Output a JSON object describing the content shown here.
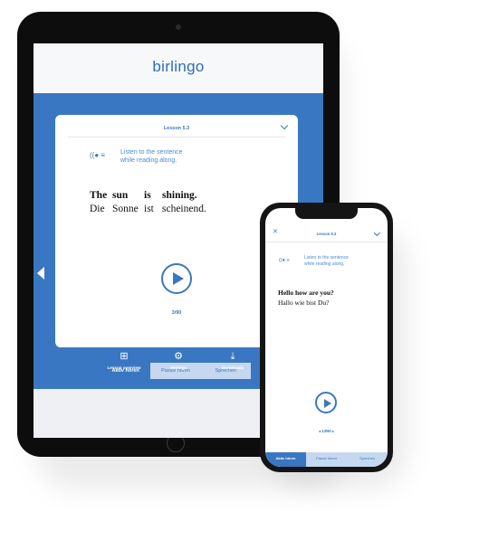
{
  "tablet": {
    "logo": "birlingo",
    "lesson_title": "Lesson 5.3",
    "instruction_line1": "Listen to the sentence",
    "instruction_line2": "while reading along.",
    "sentence_en": [
      "The",
      "sun",
      "is",
      "shining."
    ],
    "sentence_de": [
      "Die",
      "Sonne",
      "ist",
      "scheinend."
    ],
    "counter": "3/90",
    "tabs": [
      {
        "label": "Aktiv hören",
        "active": true
      },
      {
        "label": "Passiv hören",
        "active": false
      },
      {
        "label": "Sprechen",
        "active": false
      }
    ],
    "nav": [
      {
        "label": "Lesson overview",
        "icon": "grid-icon",
        "glyph": "⊞"
      },
      {
        "label": "Settings",
        "icon": "gear-icon",
        "glyph": "⚙"
      },
      {
        "label": "Downloads",
        "icon": "download-icon",
        "glyph": "⤓"
      }
    ],
    "playback_progress": 0.03
  },
  "phone": {
    "close_glyph": "✕",
    "lesson_title": "Lesson 5.3",
    "instruction_line1": "Listen to the sentence",
    "instruction_line2": "while reading along.",
    "sentence_en": "Hello how are you?",
    "sentence_de": "Hallo wie bist Du?",
    "pager": "◂ 13/90 ▸",
    "tabs": [
      {
        "label": "Aktiv hören",
        "active": true
      },
      {
        "label": "Passiv hören",
        "active": false
      },
      {
        "label": "Sprechen",
        "active": false
      }
    ]
  },
  "colors": {
    "brand_blue": "#3a77c2",
    "tab_inactive": "#c5d8f0",
    "device_frame": "#0d0d0d"
  }
}
